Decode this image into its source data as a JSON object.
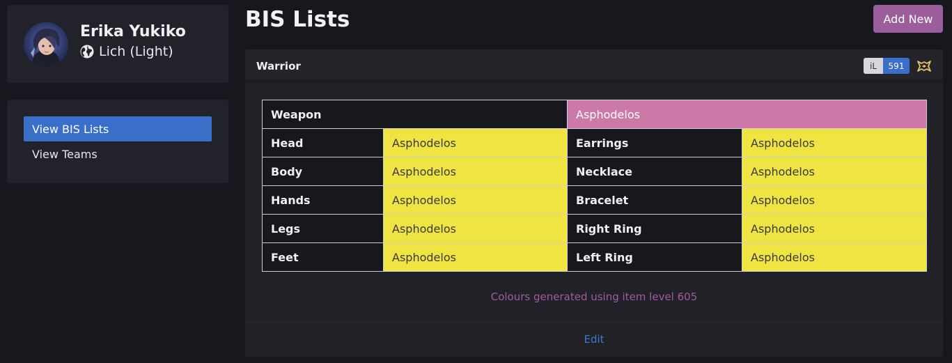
{
  "profile": {
    "name": "Erika Yukiko",
    "world": "Lich (Light)"
  },
  "nav": {
    "items": [
      {
        "label": "View BIS Lists",
        "active": true
      },
      {
        "label": "View Teams",
        "active": false
      }
    ]
  },
  "page": {
    "title": "BIS Lists",
    "add_button": "Add New"
  },
  "bis_card": {
    "job": "Warrior",
    "item_level_label": "iL",
    "item_level": "591",
    "weapon": {
      "slot": "Weapon",
      "item": "Asphodelos"
    },
    "rows": [
      {
        "left_slot": "Head",
        "left_item": "Asphodelos",
        "right_slot": "Earrings",
        "right_item": "Asphodelos"
      },
      {
        "left_slot": "Body",
        "left_item": "Asphodelos",
        "right_slot": "Necklace",
        "right_item": "Asphodelos"
      },
      {
        "left_slot": "Hands",
        "left_item": "Asphodelos",
        "right_slot": "Bracelet",
        "right_item": "Asphodelos"
      },
      {
        "left_slot": "Legs",
        "left_item": "Asphodelos",
        "right_slot": "Right Ring",
        "right_item": "Asphodelos"
      },
      {
        "left_slot": "Feet",
        "left_item": "Asphodelos",
        "right_slot": "Left Ring",
        "right_item": "Asphodelos"
      }
    ],
    "colour_note": "Colours generated using item level 605",
    "edit_label": "Edit"
  },
  "colors": {
    "accent_blue": "#3a6fc9",
    "button_purple": "#9b5e9b",
    "item_yellow": "#f0e442",
    "item_pink": "#cc79a7",
    "note_purple": "#a05ba0"
  },
  "icons": [
    "avatar",
    "globe-icon",
    "warrior-job-icon"
  ]
}
